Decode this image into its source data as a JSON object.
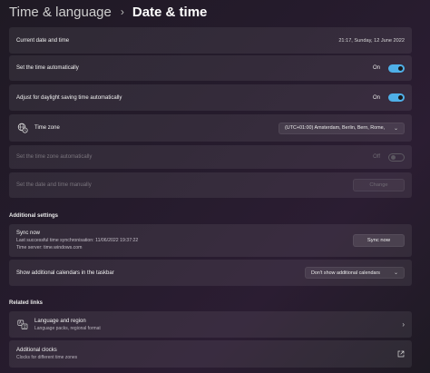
{
  "header": {
    "parent": "Time & language",
    "separator": "›",
    "current": "Date & time"
  },
  "rows": {
    "current_date": {
      "label": "Current date and time",
      "value": "21:17, Sunday, 12 June 2022"
    },
    "auto_time": {
      "label": "Set the time automatically",
      "state": "On",
      "checked": true
    },
    "dst": {
      "label": "Adjust for daylight saving time automatically",
      "state": "On",
      "checked": true
    },
    "time_zone": {
      "label": "Time zone",
      "value": "(UTC+01:00) Amsterdam, Berlin, Bern, Rome,",
      "icon": "globe-clock-icon"
    },
    "auto_zone": {
      "label": "Set the time zone automatically",
      "state": "Off",
      "checked": false
    },
    "manual": {
      "label": "Set the date and time manually",
      "button": "Change"
    }
  },
  "additional": {
    "heading": "Additional settings",
    "sync": {
      "title": "Sync now",
      "last": "Last successful time synchronisation: 11/06/2022 19:37:22",
      "server": "Time server: time.windows.com",
      "button": "Sync now"
    },
    "calendars": {
      "label": "Show additional calendars in the taskbar",
      "value": "Don't show additional calendars"
    }
  },
  "related": {
    "heading": "Related links",
    "language": {
      "title": "Language and region",
      "sub": "Language packs, regional format",
      "icon": "language-icon"
    },
    "clocks": {
      "title": "Additional clocks",
      "sub": "Clocks for different time zones",
      "icon": "external-link-icon"
    }
  },
  "colors": {
    "accent": "#4fb0e8",
    "card": "#2a2430"
  }
}
